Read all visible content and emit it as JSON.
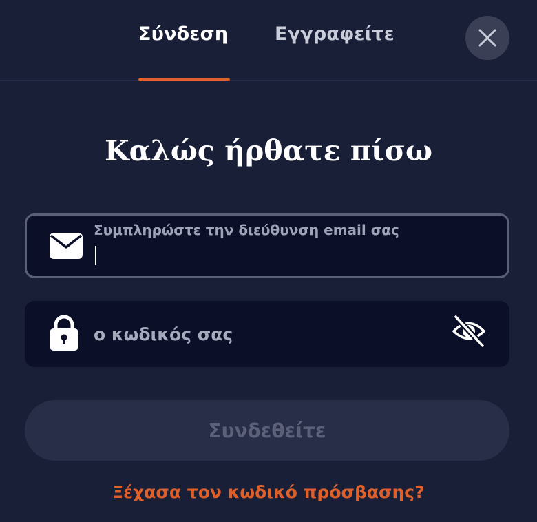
{
  "tabs": [
    {
      "label": "Σύνδεση",
      "active": true
    },
    {
      "label": "Εγγραφείτε",
      "active": false
    }
  ],
  "heading": "Καλώς ήρθατε πίσω",
  "email": {
    "label": "Συμπληρώστε την διεύθυνση email σας",
    "value": ""
  },
  "password": {
    "placeholder": "ο κωδικός σας",
    "value": ""
  },
  "submit_label": "Συνδεθείτε",
  "forgot_label": "Ξέχασα τον κωδικό πρόσβασης?",
  "icons": {
    "close": "close-icon",
    "email": "envelope-icon",
    "lock": "lock-icon",
    "visibility": "eye-off-icon"
  },
  "colors": {
    "background": "#1a1f38",
    "input_background": "#0b0f27",
    "accent": "#e0602a",
    "button_disabled": "#292e48",
    "button_disabled_text": "#5c6179"
  }
}
